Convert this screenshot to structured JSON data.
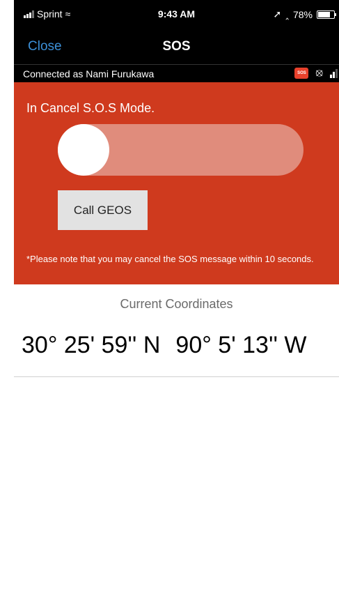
{
  "status_bar": {
    "carrier": "Sprint",
    "time": "9:43 AM",
    "battery_text": "78%",
    "battery_level": 0.78
  },
  "nav": {
    "close_label": "Close",
    "title": "SOS"
  },
  "connection": {
    "text": "Connected as Nami Furukawa",
    "sos_badge": "SOS",
    "icons": [
      "sos-badge-icon",
      "satellite-icon",
      "signal-icon"
    ]
  },
  "alert": {
    "mode_text": "In Cancel S.O.S Mode.",
    "slider_position": 0,
    "call_button_label": "Call GEOS",
    "note": "*Please note that you may cancel the SOS message within 10 seconds.",
    "background_color": "#cf3a1e",
    "track_color": "#e08c7c"
  },
  "coordinates": {
    "label": "Current Coordinates",
    "latitude": "30° 25' 59'' N",
    "longitude": "90° 5' 13'' W"
  },
  "colors": {
    "link_blue": "#3c8fd6",
    "bar_black": "#000000"
  }
}
